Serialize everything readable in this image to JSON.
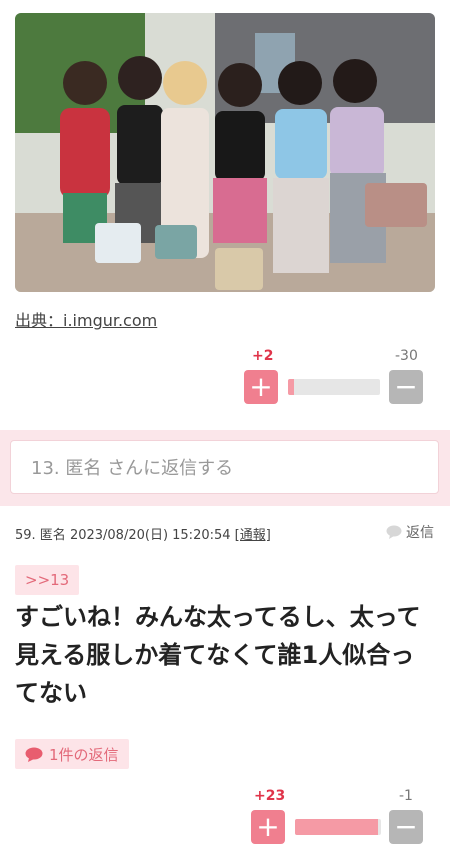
{
  "post_top": {
    "image_alt": "group photo",
    "source_label": "出典：i.imgur.com",
    "votes": {
      "plus_label": "+2",
      "minus_label": "-30",
      "plus_share": 0.06
    }
  },
  "reply_box": {
    "placeholder": "13. 匿名 さんに返信する"
  },
  "comment": {
    "meta": "59. 匿名 2023/08/20(日) 15:20:54",
    "report_label": "[通報]",
    "reply_label": "返信",
    "anchor": ">>13",
    "text": "すごいね！みんな太ってるし、太って見える服しか着てなくて誰1人似合ってない",
    "reply_count_label": "1件の返信",
    "votes": {
      "plus_label": "+23",
      "minus_label": "-1",
      "plus_share": 0.96
    }
  },
  "icons": {
    "plus": "plus-icon",
    "minus": "minus-icon",
    "speech": "speech-bubble-icon"
  },
  "colors": {
    "accent": "#f07f8f",
    "accent_text": "#e36a7a",
    "band": "#fbe6ea"
  }
}
